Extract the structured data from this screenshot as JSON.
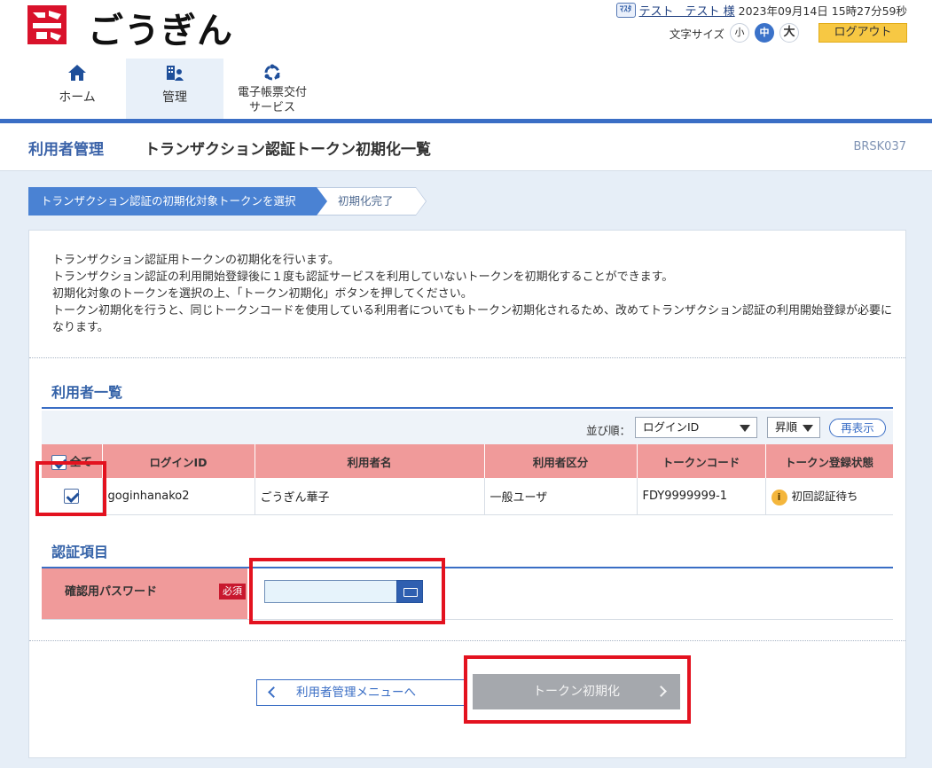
{
  "header": {
    "brand_name": "ごうぎん",
    "user_icon_text": "ﾏｽﾀ",
    "user_name": "テスト　テスト 様",
    "datetime": "2023年09月14日 15時27分59秒",
    "font_size_label": "文字サイズ",
    "font_small": "小",
    "font_medium": "中",
    "font_large": "大",
    "logout": "ログアウト"
  },
  "nav": {
    "home": "ホーム",
    "admin": "管理",
    "ledger_line1": "電子帳票交付",
    "ledger_line2": "サービス"
  },
  "title": {
    "section": "利用者管理",
    "page": "トランザクション認証トークン初期化一覧",
    "screen_code": "BRSK037"
  },
  "steps": {
    "step1": "トランザクション認証の初期化対象トークンを選択",
    "step2": "初期化完了"
  },
  "intro": {
    "line1": "トランザクション認証用トークンの初期化を行います。",
    "line2": "トランザクション認証の利用開始登録後に１度も認証サービスを利用していないトークンを初期化することができます。",
    "line3": "初期化対象のトークンを選択の上、「トークン初期化」ボタンを押してください。",
    "line4": "トークン初期化を行うと、同じトークンコードを使用している利用者についてもトークン初期化されるため、改めてトランザクション認証の利用開始登録が必要になります。"
  },
  "user_list": {
    "heading": "利用者一覧",
    "sort_label": "並び順：",
    "sort_field": "ログインID",
    "sort_order": "昇順",
    "refresh": "再表示",
    "columns": {
      "all": "全て",
      "login_id": "ログインID",
      "user_name": "利用者名",
      "user_type": "利用者区分",
      "token_code": "トークンコード",
      "token_status": "トークン登録状態"
    },
    "rows": [
      {
        "checked": true,
        "login_id": "goginhanako2",
        "user_name": "ごうぎん華子",
        "user_type": "一般ユーザ",
        "token_code": "FDY9999999-1",
        "token_status": "初回認証待ち"
      }
    ]
  },
  "auth": {
    "heading": "認証項目",
    "password_label": "確認用パスワード",
    "required": "必須",
    "password_value": ""
  },
  "buttons": {
    "back": "利用者管理メニューへ",
    "token_init": "トークン初期化"
  },
  "colors": {
    "brand_red": "#d9122b",
    "primary_blue": "#3a6ec5",
    "table_header_pink": "#f09a9a",
    "logout_yellow": "#f7c843",
    "highlight_red": "#e3121f"
  }
}
